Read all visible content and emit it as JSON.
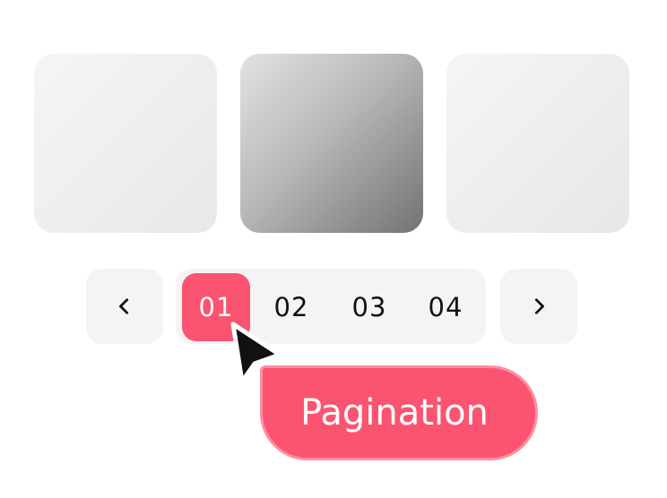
{
  "gallery": {
    "cards": [
      {
        "name": "card-1"
      },
      {
        "name": "card-2"
      },
      {
        "name": "card-3"
      }
    ]
  },
  "pagination": {
    "prev_icon": "chevron-left-icon",
    "next_icon": "chevron-right-icon",
    "pages": [
      "01",
      "02",
      "03",
      "04"
    ],
    "active_page": "01"
  },
  "tooltip": {
    "label": "Pagination"
  },
  "colors": {
    "accent": "#fb5470",
    "accent_border": "#ff8da0",
    "pill_bg": "#f5f3f3",
    "text": "#111111"
  }
}
